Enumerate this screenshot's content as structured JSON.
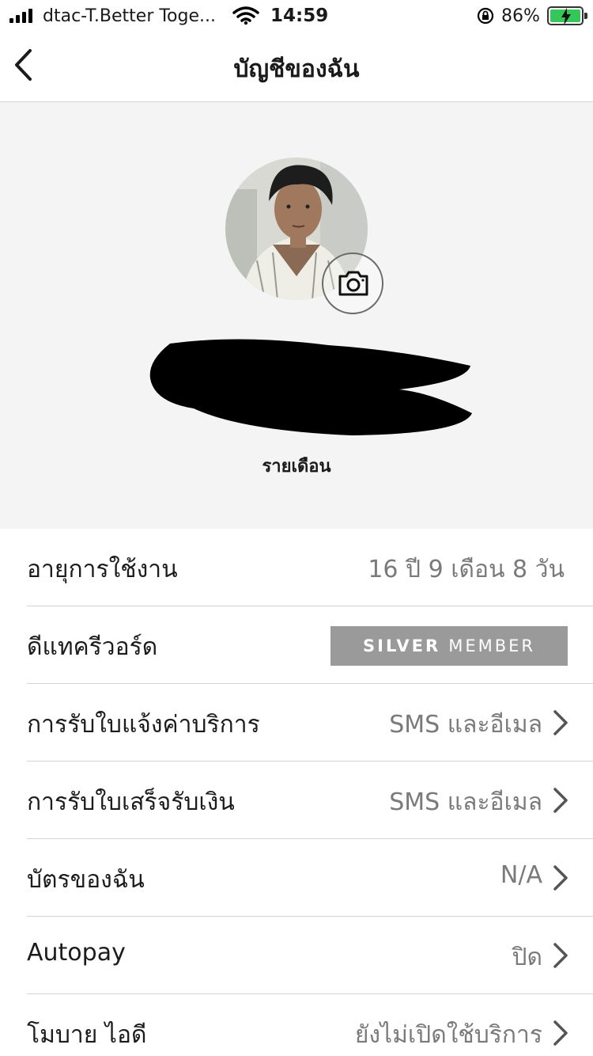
{
  "status_bar": {
    "carrier": "dtac-T.Better Toge...",
    "time": "14:59",
    "battery_percent": "86%"
  },
  "header": {
    "title": "บัญชีของฉัน"
  },
  "profile": {
    "plan": "รายเดือน"
  },
  "rows": [
    {
      "label": "อายุการใช้งาน",
      "value": "16 ปี 9 เดือน 8 วัน"
    },
    {
      "label": "ดีแทครีวอร์ด",
      "badge_main": "SILVER",
      "badge_sub": "MEMBER"
    },
    {
      "label": "การรับใบแจ้งค่าบริการ",
      "value": "SMS และอีเมล"
    },
    {
      "label": "การรับใบเสร็จรับเงิน",
      "value": "SMS และอีเมล"
    },
    {
      "label": "บัตรของฉัน",
      "value": "N/A"
    },
    {
      "label": "Autopay",
      "value": "ปิด"
    },
    {
      "label": "โมบาย ไอดี",
      "value": "ยังไม่เปิดใช้บริการ"
    }
  ],
  "icons": {
    "back": "chevron-left-icon",
    "camera": "camera-icon",
    "row_arrow": "chevron-right-icon",
    "wifi": "wifi-icon",
    "rotation_lock": "rotation-lock-icon",
    "battery": "battery-charging-icon"
  },
  "colors": {
    "profile_bg": "#f4f4f4",
    "badge_bg": "#9a9a9a",
    "value_text": "#7a7a7a",
    "battery_fill": "#35c759"
  }
}
